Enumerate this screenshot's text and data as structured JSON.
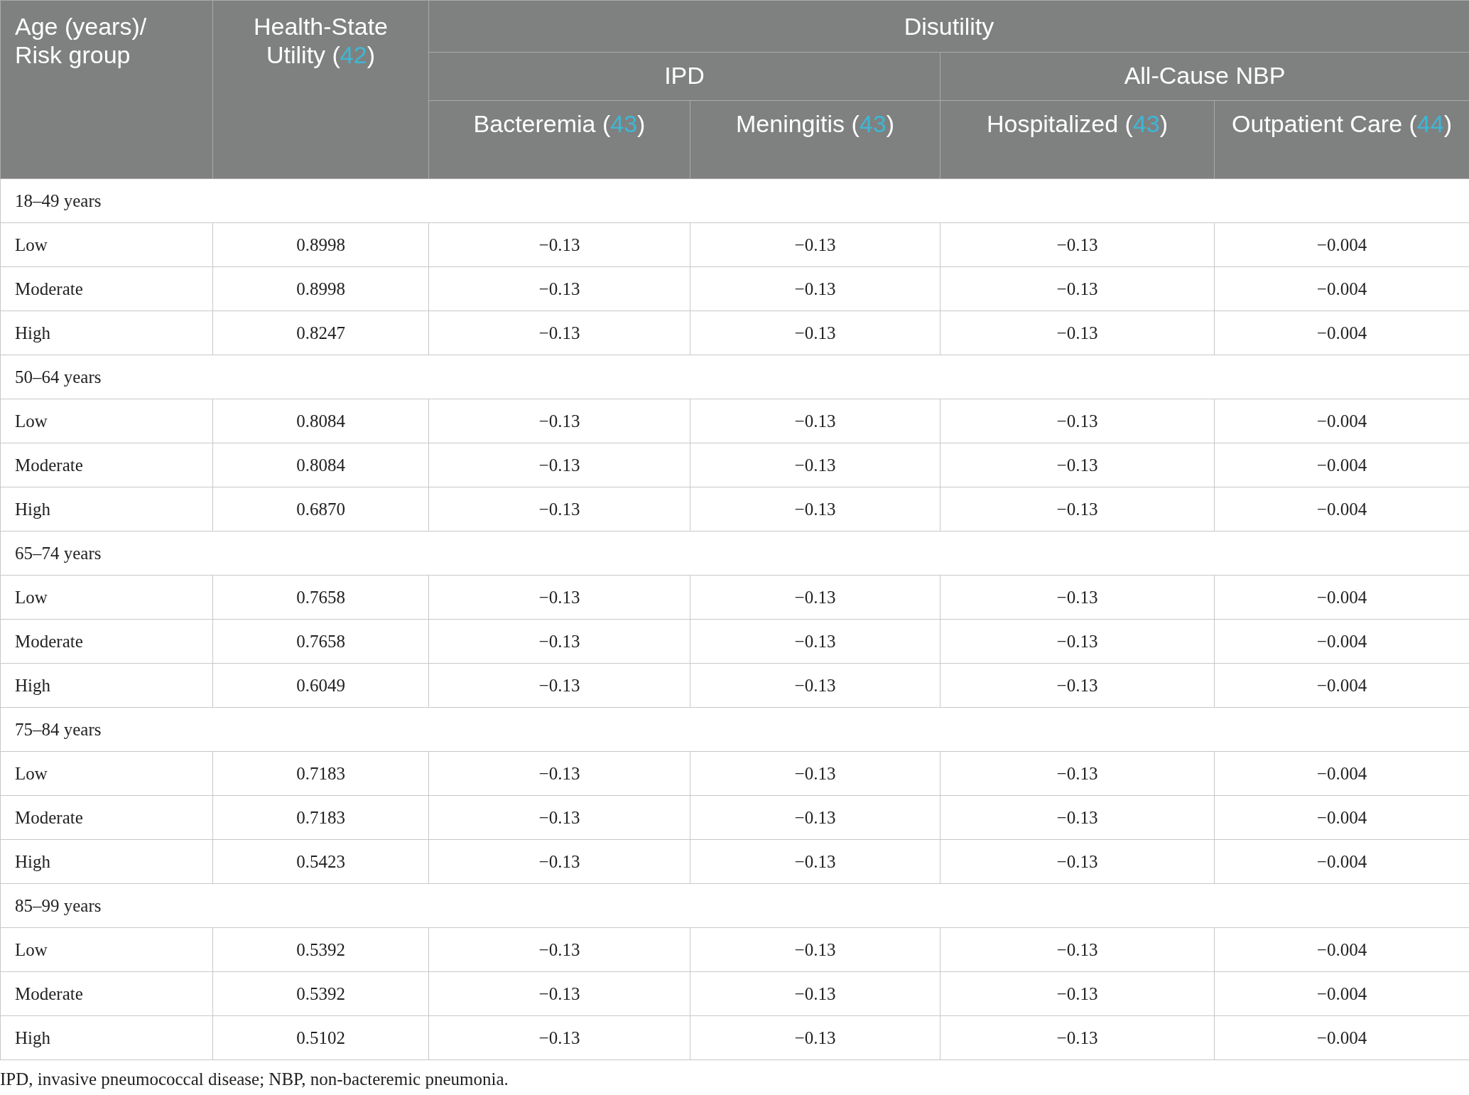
{
  "table": {
    "header": {
      "row_label": "Age (years)/ Risk group",
      "utility": {
        "text_before": "Health-State Utility (",
        "ref": "42",
        "text_after": ")"
      },
      "disutility": "Disutility",
      "groups": [
        {
          "label": "IPD",
          "columns": [
            {
              "text_before": "Bacteremia (",
              "ref": "43",
              "text_after": ")"
            },
            {
              "text_before": "Meningitis (",
              "ref": "43",
              "text_after": ")"
            }
          ]
        },
        {
          "label": "All-Cause NBP",
          "columns": [
            {
              "text_before": "Hospitalized (",
              "ref": "43",
              "text_after": ")"
            },
            {
              "text_before": "Outpatient Care (",
              "ref": "44",
              "text_after": ")"
            }
          ]
        }
      ]
    },
    "groups": [
      {
        "label": "18–49 years",
        "rows": [
          {
            "risk": "Low",
            "utility": "0.8998",
            "values": [
              "−0.13",
              "−0.13",
              "−0.13",
              "−0.004"
            ]
          },
          {
            "risk": "Moderate",
            "utility": "0.8998",
            "values": [
              "−0.13",
              "−0.13",
              "−0.13",
              "−0.004"
            ]
          },
          {
            "risk": "High",
            "utility": "0.8247",
            "values": [
              "−0.13",
              "−0.13",
              "−0.13",
              "−0.004"
            ]
          }
        ]
      },
      {
        "label": "50–64 years",
        "rows": [
          {
            "risk": "Low",
            "utility": "0.8084",
            "values": [
              "−0.13",
              "−0.13",
              "−0.13",
              "−0.004"
            ]
          },
          {
            "risk": "Moderate",
            "utility": "0.8084",
            "values": [
              "−0.13",
              "−0.13",
              "−0.13",
              "−0.004"
            ]
          },
          {
            "risk": "High",
            "utility": "0.6870",
            "values": [
              "−0.13",
              "−0.13",
              "−0.13",
              "−0.004"
            ]
          }
        ]
      },
      {
        "label": "65–74 years",
        "rows": [
          {
            "risk": "Low",
            "utility": "0.7658",
            "values": [
              "−0.13",
              "−0.13",
              "−0.13",
              "−0.004"
            ]
          },
          {
            "risk": "Moderate",
            "utility": "0.7658",
            "values": [
              "−0.13",
              "−0.13",
              "−0.13",
              "−0.004"
            ]
          },
          {
            "risk": "High",
            "utility": "0.6049",
            "values": [
              "−0.13",
              "−0.13",
              "−0.13",
              "−0.004"
            ]
          }
        ]
      },
      {
        "label": "75–84 years",
        "rows": [
          {
            "risk": "Low",
            "utility": "0.7183",
            "values": [
              "−0.13",
              "−0.13",
              "−0.13",
              "−0.004"
            ]
          },
          {
            "risk": "Moderate",
            "utility": "0.7183",
            "values": [
              "−0.13",
              "−0.13",
              "−0.13",
              "−0.004"
            ]
          },
          {
            "risk": "High",
            "utility": "0.5423",
            "values": [
              "−0.13",
              "−0.13",
              "−0.13",
              "−0.004"
            ]
          }
        ]
      },
      {
        "label": "85–99 years",
        "rows": [
          {
            "risk": "Low",
            "utility": "0.5392",
            "values": [
              "−0.13",
              "−0.13",
              "−0.13",
              "−0.004"
            ]
          },
          {
            "risk": "Moderate",
            "utility": "0.5392",
            "values": [
              "−0.13",
              "−0.13",
              "−0.13",
              "−0.004"
            ]
          },
          {
            "risk": "High",
            "utility": "0.5102",
            "values": [
              "−0.13",
              "−0.13",
              "−0.13",
              "−0.004"
            ]
          }
        ]
      }
    ]
  },
  "footnote": "IPD, invasive pneumococcal disease; NBP, non-bacteremic pneumonia."
}
